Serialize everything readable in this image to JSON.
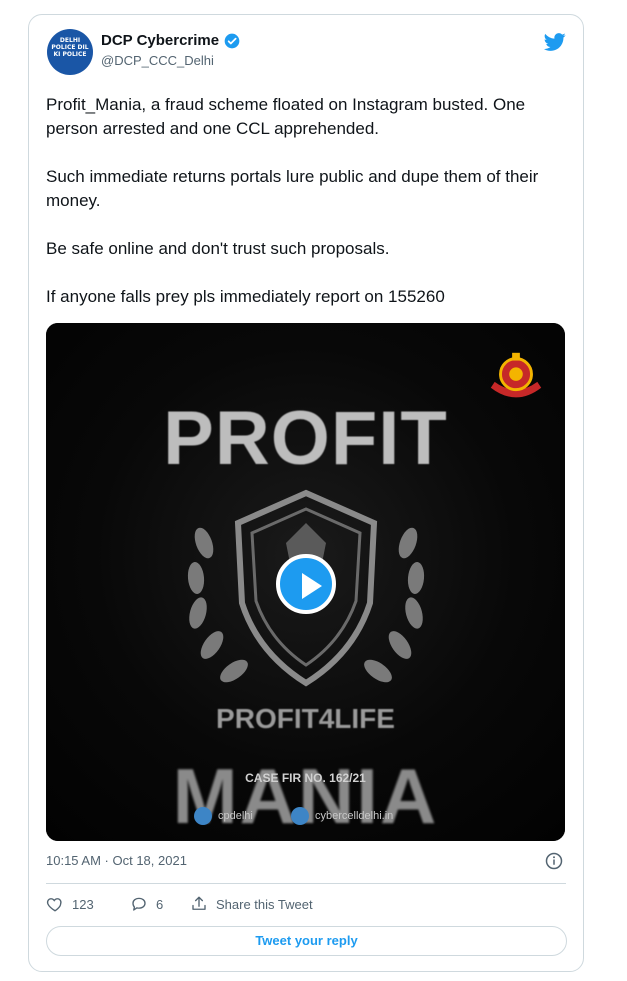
{
  "author": {
    "name": "DCP Cybercrime",
    "handle": "@DCP_CCC_Delhi",
    "avatar_text": "DELHI POLICE DIL KI POLICE"
  },
  "tweet": {
    "paragraphs": [
      "Profit_Mania, a fraud scheme floated on Instagram busted. One person arrested and one CCL apprehended.",
      "Such immediate returns portals lure public and dupe them of their money.",
      "Be safe online and don't trust such proposals.",
      "If anyone falls prey pls immediately report on 155260"
    ],
    "timestamp": "10:15 AM · Oct 18, 2021"
  },
  "media": {
    "title_top": "PROFIT",
    "brand": "PROFIT4LIFE",
    "title_bottom": "MANIA",
    "case": "CASE FIR NO. 162/21",
    "twitter_tag": "cpdelhi",
    "web_tag": "cybercelldelhi.in"
  },
  "actions": {
    "likes": "123",
    "replies": "6",
    "share_label": "Share this Tweet",
    "reply_button": "Tweet your reply"
  },
  "colors": {
    "accent": "#1d9bf0",
    "text": "#0f1419",
    "secondary": "#536471",
    "border": "#cfd9de"
  },
  "icons": [
    "verified-badge-icon",
    "twitter-bird-icon",
    "play-icon",
    "info-icon",
    "heart-icon",
    "reply-icon",
    "share-icon",
    "police-emblem-icon"
  ]
}
